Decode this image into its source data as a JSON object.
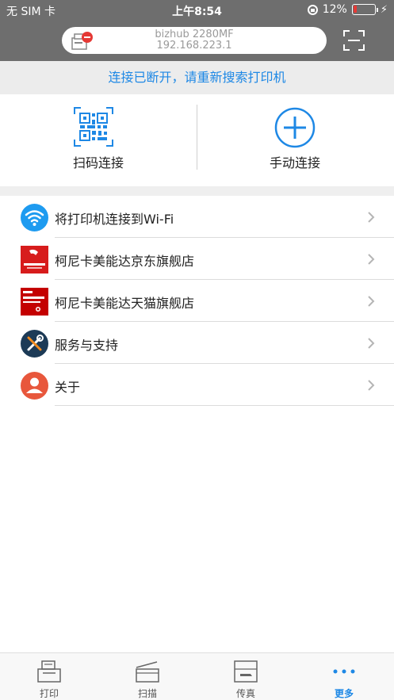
{
  "status_bar": {
    "carrier": "无 SIM 卡",
    "time": "上午8:54",
    "battery": "12%"
  },
  "header": {
    "printer_name": "bizhub 2280MF",
    "printer_ip": "192.168.223.1"
  },
  "banner": {
    "message": "连接已断开，请重新搜索打印机"
  },
  "quick_connect": [
    {
      "label": "扫码连接",
      "icon": "qr-code-icon"
    },
    {
      "label": "手动连接",
      "icon": "plus-circle-icon"
    }
  ],
  "menu": [
    {
      "label": "将打印机连接到Wi-Fi",
      "icon": "wifi-icon"
    },
    {
      "label": "柯尼卡美能达京东旗舰店",
      "icon": "jd-store-icon"
    },
    {
      "label": "柯尼卡美能达天猫旗舰店",
      "icon": "tmall-store-icon"
    },
    {
      "label": "服务与支持",
      "icon": "tools-icon"
    },
    {
      "label": "关于",
      "icon": "user-icon"
    }
  ],
  "tabs": [
    {
      "label": "打印",
      "icon": "print-icon",
      "active": false
    },
    {
      "label": "扫描",
      "icon": "scan-icon",
      "active": false
    },
    {
      "label": "传真",
      "icon": "fax-icon",
      "active": false
    },
    {
      "label": "更多",
      "icon": "more-icon",
      "active": true
    }
  ],
  "colors": {
    "accent": "#1e88e5",
    "header_bg": "#6e6e6e",
    "banner_bg": "#ececec"
  }
}
